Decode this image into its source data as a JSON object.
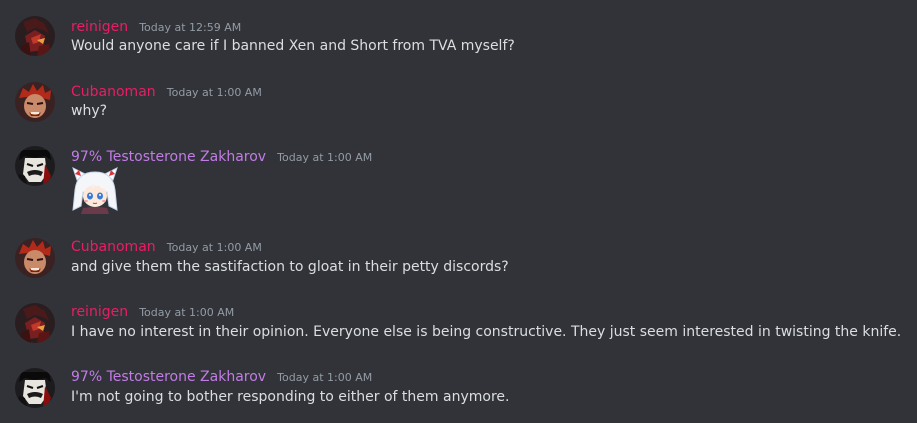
{
  "colors": {
    "background": "#313338",
    "message_text": "#dbdee1",
    "timestamp": "#949ba4"
  },
  "users": {
    "reinigen": {
      "name": "reinigen",
      "color": "#e91e63",
      "avatar_icon": "red-dark-character-avatar-icon"
    },
    "cubanoman": {
      "name": "Cubanoman",
      "color": "#e91e63",
      "avatar_icon": "red-haired-brawler-avatar-icon"
    },
    "zakharov": {
      "name": "97% Testosterone Zakharov",
      "color": "#c27ce6",
      "avatar_icon": "pale-mustached-man-avatar-icon"
    }
  },
  "messages": [
    {
      "author": "reinigen",
      "timestamp": "Today at 12:59 AM",
      "text": "Would anyone care if I banned Xen and Short from TVA myself?"
    },
    {
      "author": "Cubanoman",
      "timestamp": "Today at 1:00 AM",
      "text": "why?"
    },
    {
      "author": "97% Testosterone Zakharov",
      "timestamp": "Today at 1:00 AM",
      "text": "",
      "attachment": "white-haired-anime-girl-sticker"
    },
    {
      "author": "Cubanoman",
      "timestamp": "Today at 1:00 AM",
      "text": "and give them the sastifaction to gloat in their petty discords?"
    },
    {
      "author": "reinigen",
      "timestamp": "Today at 1:00 AM",
      "text": "I have no interest in their opinion. Everyone else is being constructive. They just seem interested in twisting the knife."
    },
    {
      "author": "97% Testosterone Zakharov",
      "timestamp": "Today at 1:00 AM",
      "text": "I'm not going to bother responding to either of them anymore."
    }
  ]
}
